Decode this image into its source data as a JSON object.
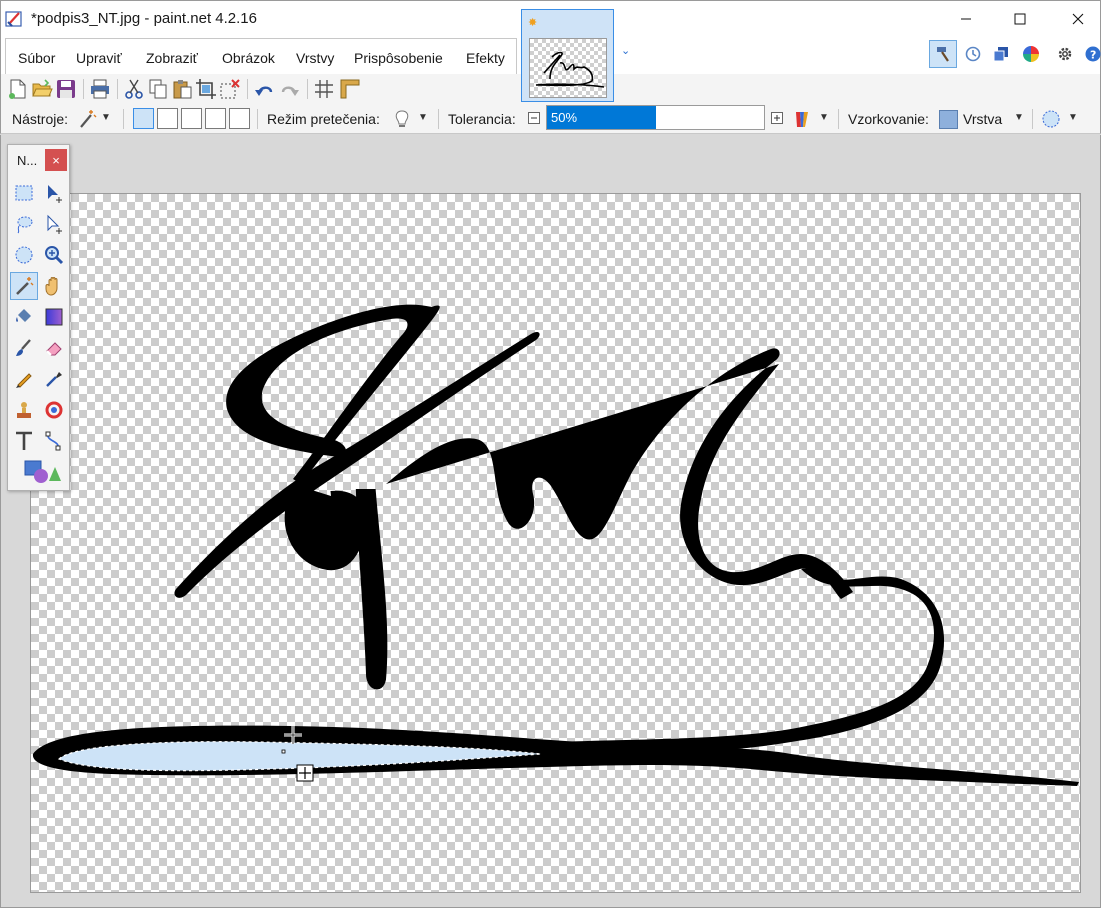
{
  "window": {
    "title": "*podpis3_NT.jpg - paint.net 4.2.16",
    "minimize_icon": "minimize-icon",
    "maximize_icon": "maximize-icon",
    "close_icon": "close-icon"
  },
  "menu": {
    "items": [
      {
        "label": "Súbor",
        "accel": "S"
      },
      {
        "label": "Upraviť",
        "accel": "U"
      },
      {
        "label": "Zobraziť",
        "accel": "Z"
      },
      {
        "label": "Obrázok",
        "accel": "O"
      },
      {
        "label": "Vrstvy",
        "accel": "V"
      },
      {
        "label": "Prispôsobenie",
        "accel": "P"
      },
      {
        "label": "Efekty",
        "accel": "E"
      }
    ]
  },
  "right_icons": [
    "tools-icon",
    "history-icon",
    "layers-icon",
    "colors-icon",
    "settings-icon",
    "help-icon"
  ],
  "toolbar": {
    "icons": [
      "new-icon",
      "open-icon",
      "save-icon",
      "print-icon",
      "cut-icon",
      "copy-icon",
      "paste-icon",
      "crop-icon",
      "deselect-icon",
      "undo-icon",
      "redo-icon",
      "grid-icon",
      "ruler-icon"
    ]
  },
  "options": {
    "tools_label": "Nástroje:",
    "flood_mode_label": "Režim pretečenia:",
    "tolerance_label": "Tolerancia:",
    "tolerance_value": "50%",
    "tolerance_fraction": 0.5,
    "sampling_label": "Vzorkovanie:",
    "sampling_value": "Vrstva"
  },
  "tools_window": {
    "title": "N...",
    "close": "×",
    "active_tool": "magic-wand"
  },
  "colors": {
    "accent": "#0078d7",
    "selection": "#cde3f7",
    "close_red": "#d45050"
  }
}
